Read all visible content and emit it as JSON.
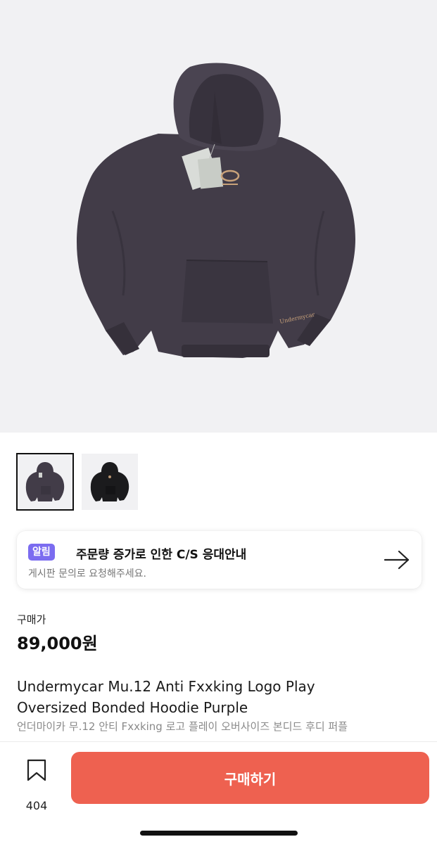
{
  "product": {
    "image_alt": "Purple oversized bonded hoodie",
    "thumbnails": [
      {
        "name": "purple hoodie",
        "active": true
      },
      {
        "name": "black hoodie",
        "active": false
      }
    ],
    "print_text": "Undermycar"
  },
  "notice": {
    "badge": "알림",
    "title": "주문량 증가로 인한 C/S 응대안내",
    "subtitle": "게시판 문의로 요청해주세요.",
    "arrow_icon": "arrow-right-icon"
  },
  "price": {
    "label": "구매가",
    "value": "89,000원"
  },
  "title": {
    "line1": "Undermycar Mu.12 Anti Fxxking Logo Play",
    "line2": "Oversized Bonded Hoodie Purple",
    "korean": "언더마이카 무.12 안티 Fxxking 로고 플레이 오버사이즈 본디드 후디 퍼플"
  },
  "bottom_bar": {
    "bookmark_icon": "bookmark-icon",
    "bookmark_count": "404",
    "buy_label": "구매하기"
  },
  "colors": {
    "accent_buy": "#ee6150",
    "badge": "#7b6cf0",
    "hoodie_purple": "#3f3a45",
    "hoodie_black": "#1b1b1d"
  }
}
